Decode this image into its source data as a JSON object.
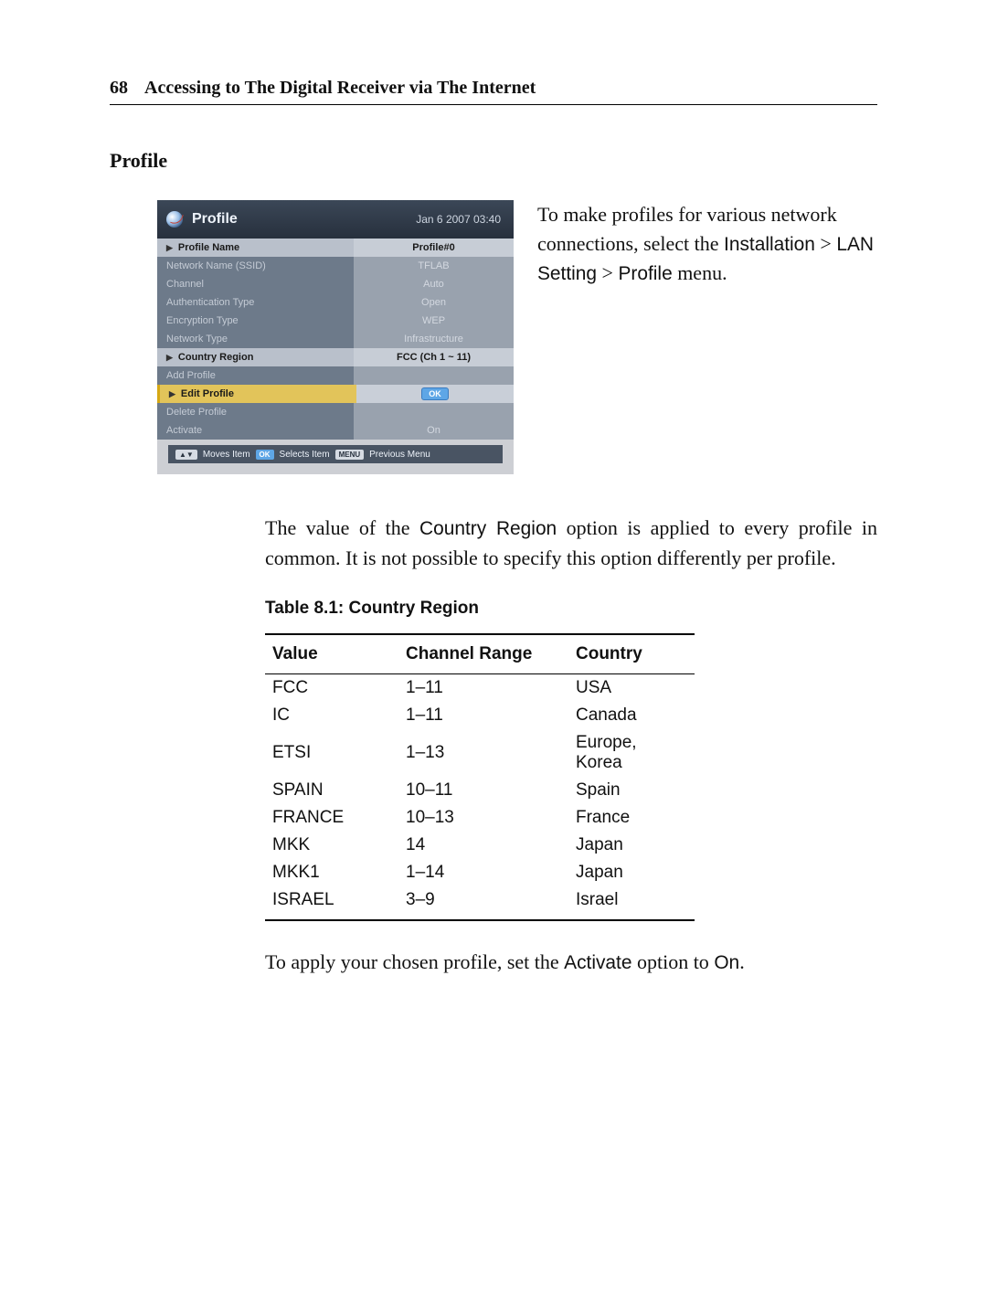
{
  "header": {
    "page_number": "68",
    "running_title": "Accessing to The Digital Receiver via The Internet"
  },
  "section_heading": "Profile",
  "intro_paragraph": {
    "before": "To make profiles for various network connections, select the ",
    "menu_path_1": "Installation",
    "gt1": " > ",
    "menu_path_2": "LAN Setting",
    "gt2": " > ",
    "menu_path_3": "Profile",
    "after": " menu."
  },
  "screenshot": {
    "title": "Profile",
    "timestamp": "Jan 6 2007 03:40",
    "rows": [
      {
        "k": "Profile Name",
        "v": "Profile#0",
        "style": "active",
        "tri": true
      },
      {
        "k": "Network Name (SSID)",
        "v": "TFLAB",
        "style": "dim"
      },
      {
        "k": "Channel",
        "v": "Auto",
        "style": "dim"
      },
      {
        "k": "Authentication Type",
        "v": "Open",
        "style": "dim"
      },
      {
        "k": "Encryption Type",
        "v": "WEP",
        "style": "dim"
      },
      {
        "k": "Network Type",
        "v": "Infrastructure",
        "style": "dim"
      },
      {
        "k": "Country Region",
        "v": "FCC (Ch 1 ~ 11)",
        "style": "active",
        "tri": true
      },
      {
        "k": "Add Profile",
        "v": "",
        "style": "dim"
      },
      {
        "k": "Edit Profile",
        "v": "OK",
        "style": "hl",
        "tri": true,
        "okpill": true
      },
      {
        "k": "Delete Profile",
        "v": "",
        "style": "dim"
      },
      {
        "k": "Activate",
        "v": "On",
        "style": "dim"
      }
    ],
    "helpbar": {
      "moves_key": "▲▼",
      "moves_label": "Moves Item",
      "selects_key": "OK",
      "selects_label": "Selects Item",
      "prev_key": "MENU",
      "prev_label": "Previous Menu"
    }
  },
  "body_paragraph": {
    "before": "The value of the ",
    "opt": "Country Region",
    "after": " option is applied to every profile in common.  It is not possible to specify this option differently per profile."
  },
  "table": {
    "caption": "Table 8.1: Country Region",
    "headers": {
      "c1": "Value",
      "c2": "Channel Range",
      "c3": "Country"
    },
    "rows": [
      {
        "c1": "FCC",
        "c2": "1–11",
        "c3": "USA"
      },
      {
        "c1": "IC",
        "c2": "1–11",
        "c3": "Canada"
      },
      {
        "c1": "ETSI",
        "c2": "1–13",
        "c3": "Europe, Korea"
      },
      {
        "c1": "SPAIN",
        "c2": "10–11",
        "c3": "Spain"
      },
      {
        "c1": "FRANCE",
        "c2": "10–13",
        "c3": "France"
      },
      {
        "c1": "MKK",
        "c2": "14",
        "c3": "Japan"
      },
      {
        "c1": "MKK1",
        "c2": "1–14",
        "c3": "Japan"
      },
      {
        "c1": "ISRAEL",
        "c2": "3–9",
        "c3": "Israel"
      }
    ]
  },
  "closing_paragraph": {
    "before": "To apply your chosen profile, set the ",
    "opt1": "Activate",
    "mid": " option to ",
    "opt2": "On",
    "after": "."
  }
}
